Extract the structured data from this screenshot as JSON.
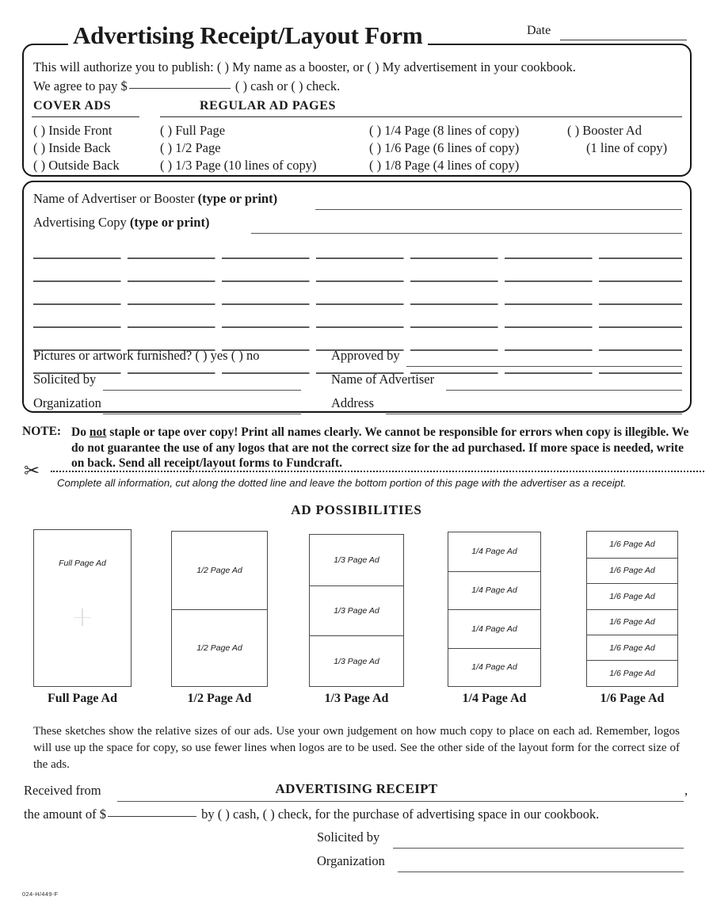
{
  "document": {
    "title": "Advertising Receipt/Layout Form",
    "date_label": "Date",
    "form_number": "024-H/449-F"
  },
  "authorize": {
    "line1": "This will authorize you to publish:  (  ) My name as a booster, or (  ) My advertisement in your cookbook.",
    "line2_prefix": "We agree to pay $",
    "line2_suffix": "(  ) cash or (  ) check."
  },
  "ad_selection": {
    "cover_heading": "COVER  ADS",
    "regular_heading": "REGULAR  AD  PAGES",
    "cover_options": [
      "(  ) Inside Front",
      "(  ) Inside Back",
      "(  ) Outside Back"
    ],
    "regular_col1": [
      "(  ) Full Page",
      "(  ) 1/2 Page",
      "(  ) 1/3 Page (10 lines of copy)"
    ],
    "regular_col2": [
      "(  ) 1/4 Page (8 lines of copy)",
      "(  ) 1/6 Page (6 lines of copy)",
      "(  ) 1/8 Page (4 lines of copy)"
    ],
    "booster": "(  ) Booster Ad",
    "booster_note": "(1 line of copy)"
  },
  "advertiser": {
    "name_label_plain": "Name of Advertiser or Booster ",
    "name_label_bold": "(type or print)",
    "copy_label_plain": "Advertising Copy ",
    "copy_label_bold": "(type or print)",
    "pictures_label": "Pictures or artwork furnished?  (  ) yes   (  ) no",
    "solicited_by_label": "Solicited by",
    "organization_label": "Organization",
    "approved_by_label": "Approved by",
    "name_of_advertiser_label": "Name of Advertiser",
    "address_label": "Address"
  },
  "note": {
    "label": "NOTE:",
    "part1": "Do ",
    "underlined": "not",
    "part2": " staple or tape over copy!  Print all names clearly.  We cannot be responsible for errors when copy is illegible.  We do not guarantee the use of any logos that are not the correct size for the ad purchased.  If more space is needed, write on back.  Send all receipt/layout forms to Fundcraft."
  },
  "cut_line": {
    "scissors_icon": "scissors-icon",
    "instruction": "Complete all information, cut along the dotted line and leave the bottom portion of this page with the advertiser as a receipt."
  },
  "ad_possibilities": {
    "heading": "AD  POSSIBILITIES",
    "columns": [
      {
        "caption": "Full Page Ad",
        "cells": [
          "Full Page Ad"
        ]
      },
      {
        "caption": "1/2 Page Ad",
        "cells": [
          "1/2 Page Ad",
          "1/2 Page Ad"
        ]
      },
      {
        "caption": "1/3 Page Ad",
        "cells": [
          "1/3 Page Ad",
          "1/3 Page Ad",
          "1/3 Page Ad"
        ]
      },
      {
        "caption": "1/4 Page Ad",
        "cells": [
          "1/4 Page Ad",
          "1/4 Page Ad",
          "1/4 Page Ad",
          "1/4 Page Ad"
        ]
      },
      {
        "caption": "1/6  Page Ad",
        "cells": [
          "1/6 Page Ad",
          "1/6 Page Ad",
          "1/6 Page Ad",
          "1/6 Page Ad",
          "1/6 Page Ad",
          "1/6 Page Ad"
        ]
      }
    ],
    "description": "These sketches show the relative sizes of our ads.  Use your own judgement on how much copy to place on each ad.  Remember, logos will use up the space for copy, so use fewer lines when logos are to be used.  See the other side of the layout form for the correct size of the ads."
  },
  "receipt": {
    "heading": "ADVERTISING RECEIPT",
    "received_from_label": "Received from",
    "received_from_suffix": ",",
    "amount_prefix": "the amount of  $",
    "amount_suffix": "by  (  ) cash, (  ) check, for the purchase of advertising space in our cookbook.",
    "solicited_by_label": "Solicited by",
    "organization_label": "Organization"
  }
}
